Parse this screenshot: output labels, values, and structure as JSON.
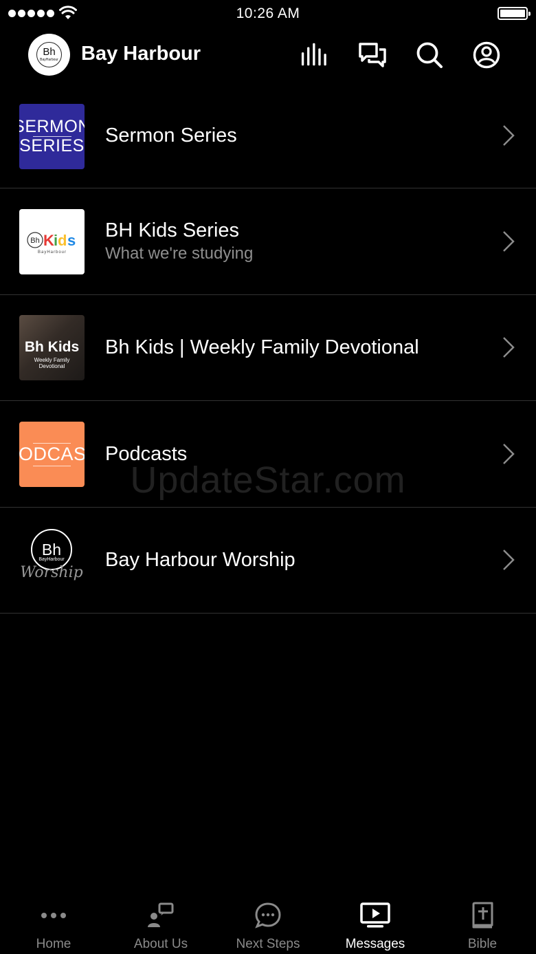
{
  "status_bar": {
    "time": "10:26 AM",
    "icons": [
      "signal-dots-icon",
      "wifi-icon",
      "battery-icon"
    ]
  },
  "header": {
    "title": "Bay Harbour",
    "logo": {
      "monogram": "Bh",
      "subtext": "BayHarbour"
    },
    "actions": [
      {
        "name": "audio-bars-icon"
      },
      {
        "name": "chat-icon"
      },
      {
        "name": "search-icon"
      },
      {
        "name": "profile-icon"
      }
    ]
  },
  "list": {
    "items": [
      {
        "title": "Sermon Series",
        "subtitle": "",
        "thumb": {
          "kind": "sermon",
          "line1": "SERMON",
          "line2": "SERIES",
          "bg": "#2f2a9a"
        }
      },
      {
        "title": "BH Kids Series",
        "subtitle": "What we're studying",
        "thumb": {
          "kind": "kids",
          "monogram": "Bh",
          "word": "Kids",
          "caption": "BayHarbour",
          "bg": "#ffffff"
        }
      },
      {
        "title": "Bh Kids | Weekly Family Devotional",
        "subtitle": "",
        "thumb": {
          "kind": "devotional",
          "big": "Bh Kids",
          "line1": "Weekly Family",
          "line2": "Devotional"
        }
      },
      {
        "title": "Podcasts",
        "subtitle": "",
        "thumb": {
          "kind": "podcast",
          "text": "PODCAST",
          "bg": "#fa8c55"
        }
      },
      {
        "title": "Bay Harbour Worship",
        "subtitle": "",
        "thumb": {
          "kind": "worship",
          "monogram": "Bh",
          "caption": "BayHarbour",
          "script": "Worship"
        }
      }
    ]
  },
  "watermark": "UpdateStar.com",
  "tabbar": {
    "tabs": [
      {
        "label": "Home",
        "icon": "more-dots-icon",
        "active": false
      },
      {
        "label": "About Us",
        "icon": "about-us-icon",
        "active": false
      },
      {
        "label": "Next Steps",
        "icon": "chat-bubble-icon",
        "active": false
      },
      {
        "label": "Messages",
        "icon": "tv-play-icon",
        "active": true
      },
      {
        "label": "Bible",
        "icon": "bible-icon",
        "active": false
      }
    ]
  },
  "colors": {
    "background": "#000000",
    "text": "#ffffff",
    "secondary_text": "#8e8e8e",
    "separator": "#333333",
    "tab_inactive": "#8a8a8a"
  }
}
